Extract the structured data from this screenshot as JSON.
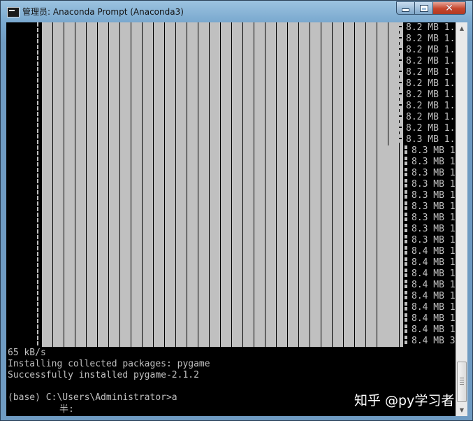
{
  "window": {
    "title": "管理员: Anaconda Prompt (Anaconda3)",
    "icon": "console-icon",
    "controls": {
      "minimize": "minimize-icon",
      "maximize": "maximize-icon",
      "close": "close-icon"
    }
  },
  "progress_rows": [
    "8.2 MB 1.",
    "8.2 MB 1.",
    "8.2 MB 1.",
    "8.2 MB 1.",
    "8.2 MB 1.",
    "8.2 MB 1.",
    "8.2 MB 1.",
    "8.2 MB 1.",
    "8.2 MB 1.",
    "8.2 MB 1.",
    "8.3 MB 1.",
    "8.3 MB 1",
    "8.3 MB 1",
    "8.3 MB 1",
    "8.3 MB 1",
    "8.3 MB 1",
    "8.3 MB 1",
    "8.3 MB 1",
    "8.3 MB 1",
    "8.3 MB 1",
    "8.4 MB 1",
    "8.4 MB 1",
    "8.4 MB 1",
    "8.4 MB 1",
    "8.4 MB 1",
    "8.4 MB 1",
    "8.4 MB 1",
    "8.4 MB 1",
    "8.4 MB 3"
  ],
  "console_lines": {
    "rate": "65 kB/s",
    "installing": "Installing collected packages: pygame",
    "success": "Successfully installed pygame-2.1.2",
    "blank": "",
    "prompt": "(base) C:\\Users\\Administrator>a",
    "ime": "半:"
  },
  "watermark": "知乎 @py学习者",
  "scrollbar": {
    "up": "scroll-up-arrow-icon",
    "down": "scroll-down-arrow-icon"
  }
}
